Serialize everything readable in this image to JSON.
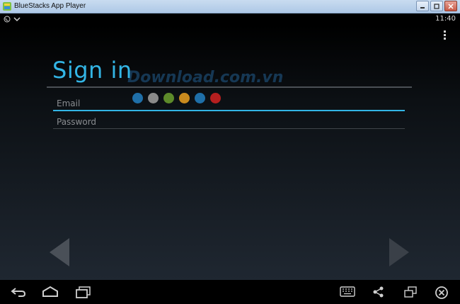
{
  "window": {
    "title": "BlueStacks App Player"
  },
  "status_bar": {
    "time": "11:40"
  },
  "signin": {
    "title": "Sign in",
    "email_placeholder": "Email",
    "password_placeholder": "Password"
  },
  "watermark": {
    "text": "Download.com.vn",
    "dot_colors": [
      "#1f6fa8",
      "#8a8a8a",
      "#5d8a2a",
      "#c98a1e",
      "#1f6fa8",
      "#b51f1f"
    ]
  },
  "colors": {
    "accent": "#33b5e5",
    "background": "#000000"
  },
  "icons": {
    "navbar": [
      "back-icon",
      "home-icon",
      "recent-apps-icon",
      "keyboard-icon",
      "share-icon",
      "multi-window-icon",
      "close-circle-icon"
    ]
  }
}
